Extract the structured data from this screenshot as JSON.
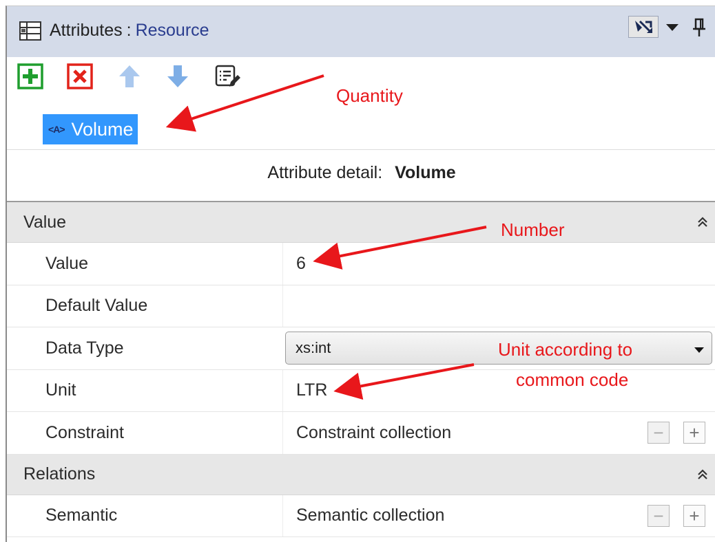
{
  "panel": {
    "title_prefix": "Attributes",
    "title_separator": ":",
    "title_resource": "Resource",
    "title_icon": "attributes-panel-icon",
    "controls": [
      "auto-hide-toggle-icon",
      "dropdown-arrow-icon",
      "pin-icon"
    ]
  },
  "toolbar": {
    "buttons": [
      {
        "name": "add",
        "icon": "plus-icon",
        "color": "#1f9e2e"
      },
      {
        "name": "delete",
        "icon": "x-icon",
        "color": "#e2231a"
      },
      {
        "name": "move-up",
        "icon": "arrow-up-icon",
        "color": "#aac8ee"
      },
      {
        "name": "move-down",
        "icon": "arrow-down-icon",
        "color": "#7eaee6"
      },
      {
        "name": "edit",
        "icon": "edit-list-icon",
        "color": "#2c2c2c"
      }
    ]
  },
  "attribute_list": {
    "selected_item": {
      "type_badge": "A",
      "name": "Volume"
    }
  },
  "detail": {
    "label": "Attribute detail:",
    "name": "Volume"
  },
  "sections": {
    "value": {
      "title": "Value",
      "rows": {
        "value": {
          "label": "Value",
          "value": "6"
        },
        "default_value": {
          "label": "Default Value",
          "value": ""
        },
        "data_type": {
          "label": "Data Type",
          "value": "xs:int"
        },
        "unit": {
          "label": "Unit",
          "value": "LTR"
        },
        "constraint": {
          "label": "Constraint",
          "value": "Constraint collection",
          "minus": "−",
          "plus": "+"
        }
      }
    },
    "relations": {
      "title": "Relations",
      "rows": {
        "semantic": {
          "label": "Semantic",
          "value": "Semantic collection",
          "minus": "−",
          "plus": "+"
        }
      }
    }
  },
  "annotations": {
    "quantity": "Quantity",
    "number": "Number",
    "unit_line1": "Unit according to",
    "unit_line2": "common code",
    "color": "#e8171b"
  },
  "colors": {
    "titlebar": "#d4dbe9",
    "title_resource": "#2a3d8f",
    "selection": "#3297fd",
    "section_bg": "#e7e7e7"
  }
}
